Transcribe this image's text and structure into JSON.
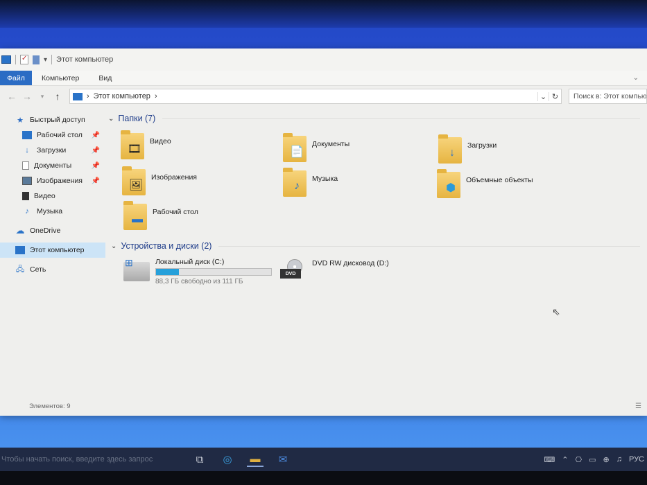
{
  "window": {
    "title": "Этот компьютер"
  },
  "ribbon": {
    "file_tab": "Файл",
    "tabs": [
      "Компьютер",
      "Вид"
    ]
  },
  "address": {
    "path_item": "Этот компьютер",
    "search_placeholder": "Поиск в: Этот компьют"
  },
  "nav": {
    "quick_access": "Быстрый доступ",
    "quick_items": [
      {
        "label": "Рабочий стол",
        "icon": "desktop-icon",
        "pinned": true
      },
      {
        "label": "Загрузки",
        "icon": "download-icon",
        "pinned": true
      },
      {
        "label": "Документы",
        "icon": "documents-icon",
        "pinned": true
      },
      {
        "label": "Изображения",
        "icon": "pictures-icon",
        "pinned": true
      },
      {
        "label": "Видео",
        "icon": "video-icon",
        "pinned": false
      },
      {
        "label": "Музыка",
        "icon": "music-icon",
        "pinned": false
      }
    ],
    "onedrive": "OneDrive",
    "this_pc": "Этот компьютер",
    "network": "Сеть"
  },
  "content": {
    "folders_header": "Папки (7)",
    "folders": [
      {
        "label": "Видео",
        "icon": "video-icon"
      },
      {
        "label": "Документы",
        "icon": "documents-icon"
      },
      {
        "label": "Загрузки",
        "icon": "download-icon"
      },
      {
        "label": "Изображения",
        "icon": "pictures-icon"
      },
      {
        "label": "Музыка",
        "icon": "music-icon"
      },
      {
        "label": "Объемные объекты",
        "icon": "3d-objects-icon"
      },
      {
        "label": "Рабочий стол",
        "icon": "desktop-icon"
      }
    ],
    "drives_header": "Устройства и диски (2)",
    "drives": [
      {
        "label": "Локальный диск (C:)",
        "free_text": "88,3 ГБ свободно из 111 ГБ",
        "used_fraction": 0.2
      },
      {
        "label": "DVD RW дисковод (D:)",
        "dvd_text": "DVD"
      }
    ]
  },
  "status": {
    "items_count": "Элементов: 9"
  },
  "taskbar": {
    "search_text": "Чтобы начать поиск, введите здесь запрос",
    "tray_lang": "РУС"
  },
  "colors": {
    "accent": "#2b6cc4",
    "selection": "#cce4f7",
    "folder": "#e6b441",
    "drive_fill": "#26a0da"
  }
}
